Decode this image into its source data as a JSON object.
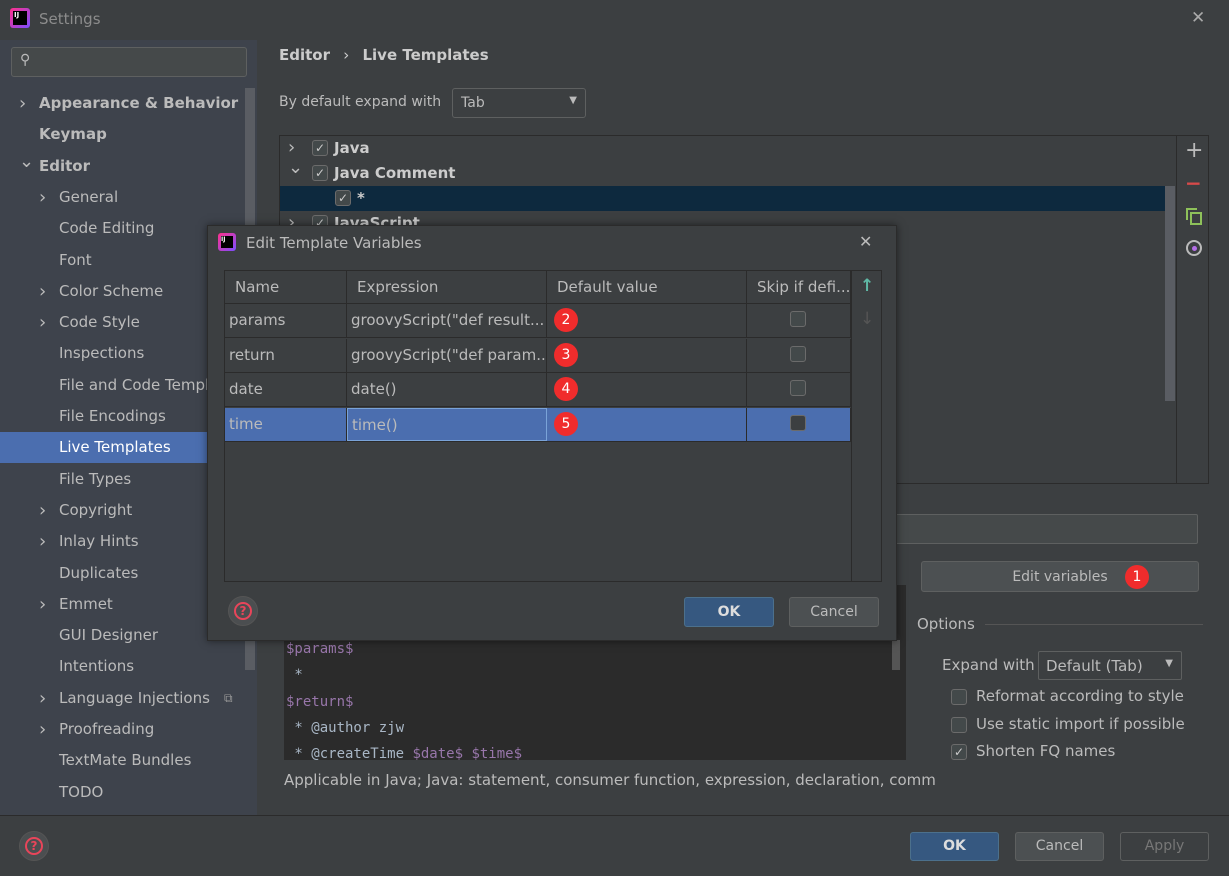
{
  "window": {
    "title": "Settings",
    "close": "✕"
  },
  "sidebar": {
    "search_placeholder": "",
    "items": [
      {
        "label": "Appearance & Behavior",
        "bold": true,
        "indent": 0,
        "chevron": ">"
      },
      {
        "label": "Keymap",
        "bold": true,
        "indent": 0,
        "chevron": ""
      },
      {
        "label": "Editor",
        "bold": true,
        "indent": 0,
        "chevron": "v"
      },
      {
        "label": "General",
        "indent": 1,
        "chevron": ">"
      },
      {
        "label": "Code Editing",
        "indent": 1,
        "chevron": ""
      },
      {
        "label": "Font",
        "indent": 1,
        "chevron": ""
      },
      {
        "label": "Color Scheme",
        "indent": 1,
        "chevron": ">"
      },
      {
        "label": "Code Style",
        "indent": 1,
        "chevron": ">"
      },
      {
        "label": "Inspections",
        "indent": 1,
        "chevron": ""
      },
      {
        "label": "File and Code Templates",
        "indent": 1,
        "chevron": ""
      },
      {
        "label": "File Encodings",
        "indent": 1,
        "chevron": ""
      },
      {
        "label": "Live Templates",
        "indent": 1,
        "chevron": "",
        "selected": true
      },
      {
        "label": "File Types",
        "indent": 1,
        "chevron": ""
      },
      {
        "label": "Copyright",
        "indent": 1,
        "chevron": ">"
      },
      {
        "label": "Inlay Hints",
        "indent": 1,
        "chevron": ">"
      },
      {
        "label": "Duplicates",
        "indent": 1,
        "chevron": ""
      },
      {
        "label": "Emmet",
        "indent": 1,
        "chevron": ">"
      },
      {
        "label": "GUI Designer",
        "indent": 1,
        "chevron": ""
      },
      {
        "label": "Intentions",
        "indent": 1,
        "chevron": ""
      },
      {
        "label": "Language Injections",
        "indent": 1,
        "chevron": ">",
        "icon": "copy-icon"
      },
      {
        "label": "Proofreading",
        "indent": 1,
        "chevron": ">"
      },
      {
        "label": "TextMate Bundles",
        "indent": 1,
        "chevron": ""
      },
      {
        "label": "TODO",
        "indent": 1,
        "chevron": ""
      }
    ]
  },
  "breadcrumb": {
    "parent": "Editor",
    "sep": "›",
    "current": "Live Templates"
  },
  "expand_default": {
    "label": "By default expand with",
    "value": "Tab"
  },
  "template_tree": [
    {
      "label": "Java",
      "checked": true,
      "chevron": ">",
      "level": 0
    },
    {
      "label": "Java Comment",
      "checked": true,
      "chevron": "v",
      "level": 0
    },
    {
      "label": "*",
      "checked": true,
      "chevron": "",
      "level": 1,
      "selected": true
    },
    {
      "label": "JavaScript",
      "checked": true,
      "chevron": ">",
      "level": 0
    }
  ],
  "tree_toolbar": {
    "add": "+",
    "remove": "−"
  },
  "edit_variables_button": "Edit variables",
  "badges": [
    "1",
    "2",
    "3",
    "4",
    "5"
  ],
  "options": {
    "title": "Options",
    "expand_label": "Expand with",
    "expand_value": "Default (Tab)",
    "checkboxes": [
      {
        "label": "Reformat according to style",
        "checked": false
      },
      {
        "label": "Use static import if possible",
        "checked": false
      },
      {
        "label": "Shorten FQ names",
        "checked": true
      }
    ]
  },
  "code_lines": [
    "$params$",
    " *",
    "$return$",
    " * @author zjw",
    " * @createTime $date$ $time$"
  ],
  "applicable": "Applicable in Java; Java: statement, consumer function, expression, declaration, comm",
  "footer": {
    "ok": "OK",
    "cancel": "Cancel",
    "apply": "Apply"
  },
  "dialog": {
    "title": "Edit Template Variables",
    "close": "✕",
    "columns": [
      "Name",
      "Expression",
      "Default value",
      "Skip if defi..."
    ],
    "rows": [
      {
        "name": "params",
        "expression": "groovyScript(\"def result...",
        "default": "",
        "skip": false
      },
      {
        "name": "return",
        "expression": "groovyScript(\"def param...",
        "default": "",
        "skip": false
      },
      {
        "name": "date",
        "expression": "date()",
        "default": "",
        "skip": false
      },
      {
        "name": "time",
        "expression": "time()",
        "default": "",
        "skip": false,
        "selected": true
      }
    ],
    "move_up": "↑",
    "move_down": "↓",
    "ok": "OK",
    "cancel": "Cancel"
  },
  "colors": {
    "accent": "#4b6eaf",
    "badge": "#f02c2c",
    "primary_button": "#365880"
  }
}
